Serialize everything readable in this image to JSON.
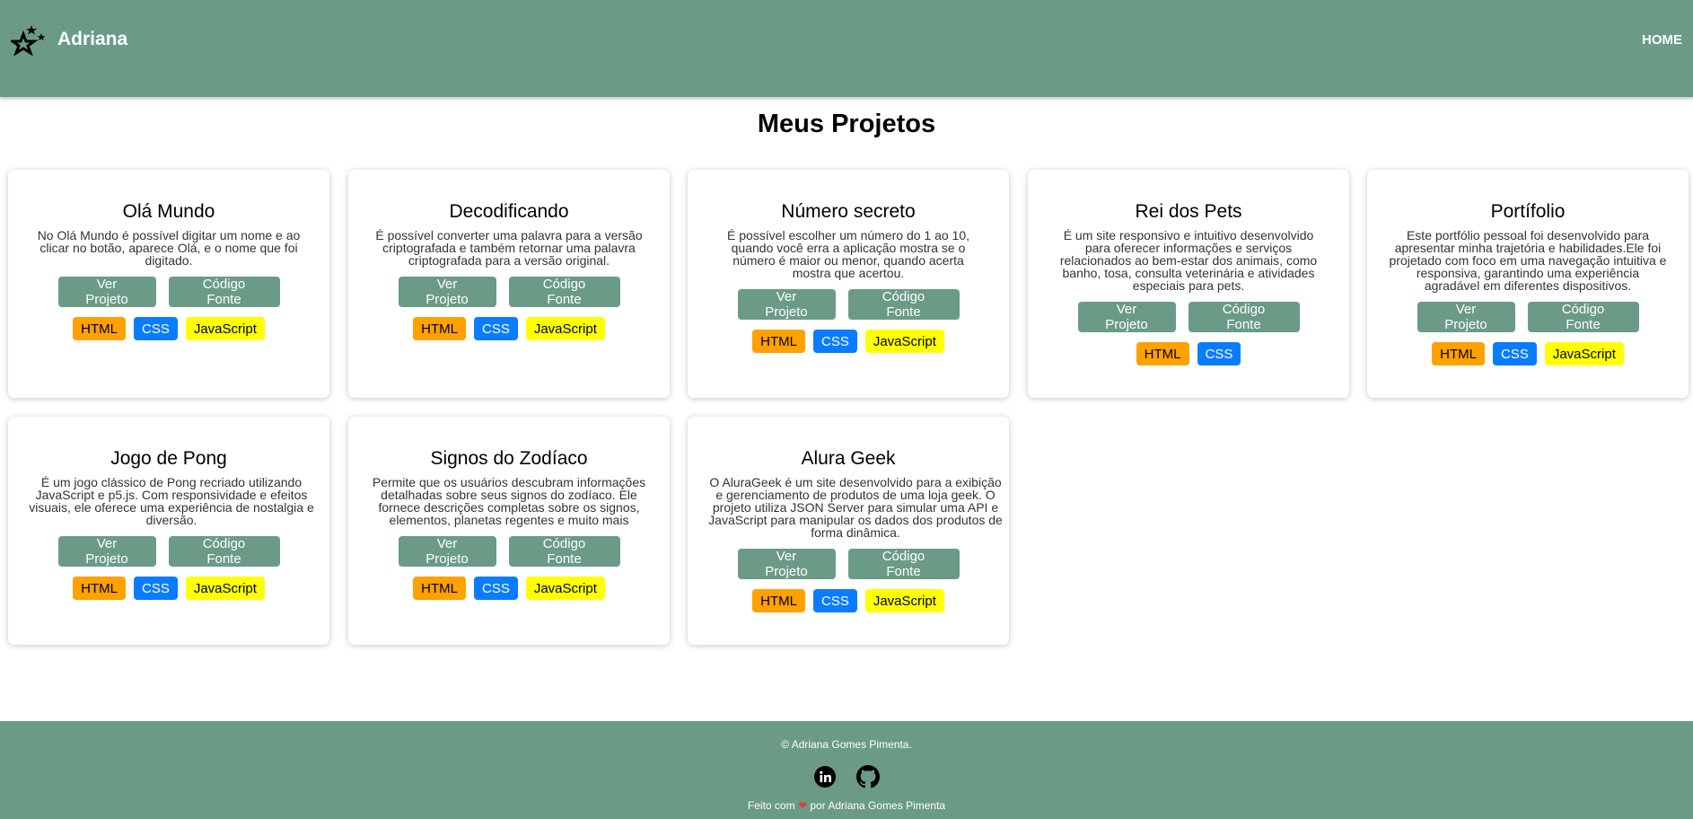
{
  "header": {
    "brand": "Adriana",
    "nav_home": "HOME"
  },
  "page_title": "Meus Projetos",
  "projects": [
    {
      "title": "Olá Mundo",
      "description": "No Olá Mundo é possível digitar um nome e ao clicar no botão, aparece Olá, e o nome que foi digitado.",
      "view_label": "Ver Projeto",
      "code_label": "Código Fonte",
      "tags": [
        "HTML",
        "CSS",
        "JavaScript"
      ]
    },
    {
      "title": "Decodificando",
      "description": "É possível converter uma palavra para a versão criptografada e também retornar uma palavra criptografada para a versão original.",
      "view_label": "Ver Projeto",
      "code_label": "Código Fonte",
      "tags": [
        "HTML",
        "CSS",
        "JavaScript"
      ]
    },
    {
      "title": "Número secreto",
      "description": "É possível escolher um número do 1 ao 10, quando você erra a aplicação mostra se o número é maior ou menor, quando acerta mostra que acertou.",
      "view_label": "Ver Projeto",
      "code_label": "Código Fonte",
      "tags": [
        "HTML",
        "CSS",
        "JavaScript"
      ]
    },
    {
      "title": "Rei dos Pets",
      "description": "É um site responsivo e intuitivo desenvolvido para oferecer informações e serviços relacionados ao bem-estar dos animais, como banho, tosa, consulta veterinária e atividades especiais para pets.",
      "view_label": "Ver Projeto",
      "code_label": "Código Fonte",
      "tags": [
        "HTML",
        "CSS"
      ]
    },
    {
      "title": "Portífolio",
      "description": "Este portfólio pessoal foi desenvolvido para apresentar minha trajetória e habilidades.Ele foi projetado com foco em uma navegação intuitiva e responsiva, garantindo uma experiência agradável em diferentes dispositivos.",
      "view_label": "Ver Projeto",
      "code_label": "Código Fonte",
      "tags": [
        "HTML",
        "CSS",
        "JavaScript"
      ]
    },
    {
      "title": "Jogo de Pong",
      "description": "É um jogo clássico de Pong recriado utilizando JavaScript e p5.js. Com responsividade e efeitos visuais, ele oferece uma experiência de nostalgia e diversão.",
      "view_label": "Ver Projeto",
      "code_label": "Código Fonte",
      "tags": [
        "HTML",
        "CSS",
        "JavaScript"
      ]
    },
    {
      "title": "Signos do Zodíaco",
      "description": "Permite que os usuários descubram informações detalhadas sobre seus signos do zodíaco. Ele fornece descrições completas sobre os signos, elementos, planetas regentes e muito mais",
      "view_label": "Ver Projeto",
      "code_label": "Código Fonte",
      "tags": [
        "HTML",
        "CSS",
        "JavaScript"
      ]
    },
    {
      "title": "Alura Geek",
      "description": "O AluraGeek é um site desenvolvido para a exibição e gerenciamento de produtos de uma loja geek. O projeto utiliza JSON Server para simular uma API e JavaScript para manipular os dados dos produtos de forma dinâmica.",
      "view_label": "Ver Projeto",
      "code_label": "Código Fonte",
      "tags": [
        "HTML",
        "CSS",
        "JavaScript"
      ]
    }
  ],
  "footer": {
    "copyright": "© Adriana Gomes Pimenta.",
    "made_with_prefix": "Feito com",
    "heart": "❤",
    "made_with_suffix": "por Adriana Gomes Pimenta",
    "social": [
      "linkedin-icon",
      "github-icon"
    ]
  },
  "colors": {
    "primary": "#6b9b87",
    "tag_html": "#ffa100",
    "tag_css": "#0a7cff",
    "tag_js": "#ffff00"
  }
}
